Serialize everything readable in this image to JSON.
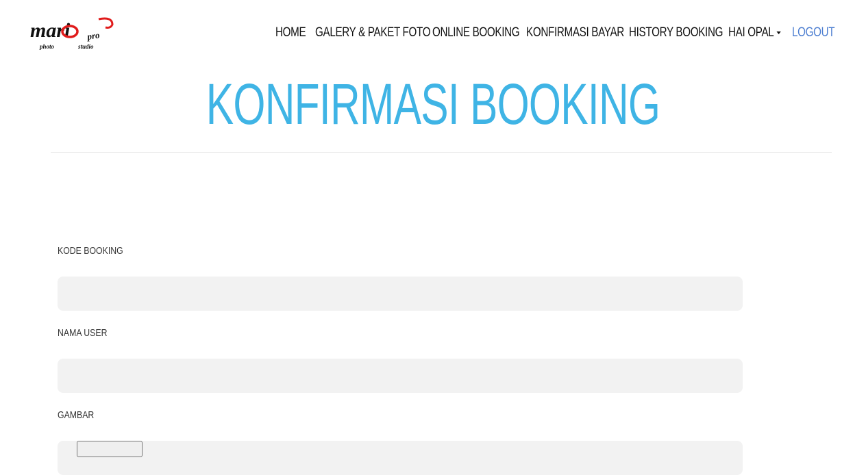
{
  "brand": {
    "logo_main": "mari",
    "logo_sub": "pro",
    "logo_tagline_left": "photo",
    "logo_tagline_right": "studio"
  },
  "nav": {
    "home": "HOME",
    "galery": "GALERY & PAKET FOTO",
    "online_booking": "ONLINE BOOKING",
    "konfirmasi_bayar": "KONFIRMASI BAYAR",
    "history_booking": "HISTORY BOOKING",
    "user_menu": "HAI OPAL",
    "logout": "LOGOUT"
  },
  "page": {
    "title": "KONFIRMASI BOOKING"
  },
  "form": {
    "kode_booking_label": "KODE BOOKING",
    "kode_booking_value": "",
    "nama_user_label": "NAMA USER",
    "nama_user_value": "",
    "gambar_label": "GAMBAR",
    "file_button_label": ""
  },
  "colors": {
    "title": "#3fb4e5",
    "logout_link": "#4e7fd1",
    "logo_red": "#e01b1b",
    "input_bg": "#f2f2f2"
  }
}
